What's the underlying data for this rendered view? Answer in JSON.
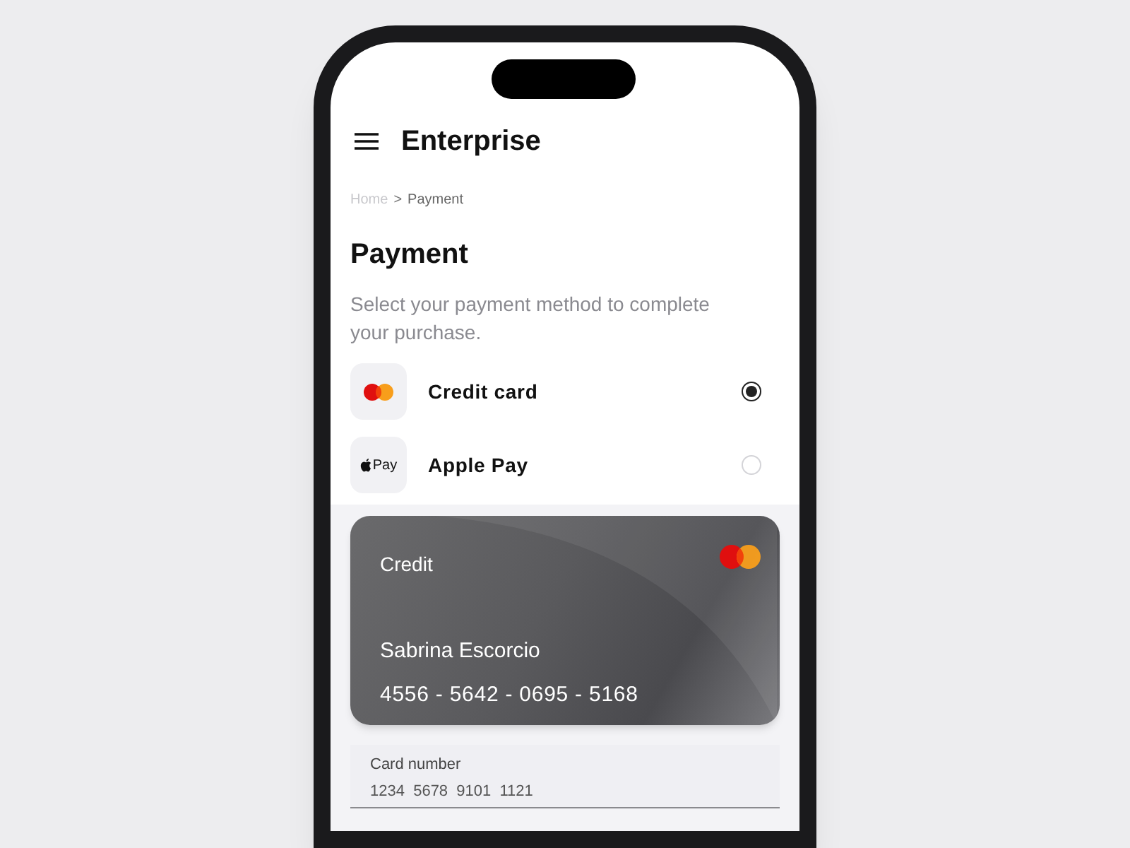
{
  "header": {
    "title": "Enterprise"
  },
  "breadcrumb": [
    {
      "label": "Home",
      "current": false
    },
    {
      "label": "Payment",
      "current": true
    }
  ],
  "breadcrumb_separator": ">",
  "heading": "Payment",
  "description": "Select your payment method to complete your purchase.",
  "methods": [
    {
      "label": "Credit card",
      "kind": "mastercard",
      "selected": true
    },
    {
      "label": "Apple Pay",
      "kind": "apple_pay",
      "icon_text": "Pay",
      "selected": false
    }
  ],
  "card": {
    "type": "Credit",
    "holder": "Sabrina Escorcio",
    "number": "4556 - 5642 - 0695 - 5168"
  },
  "field": {
    "label": "Card number",
    "value": "1234  5678  9101  1121"
  }
}
